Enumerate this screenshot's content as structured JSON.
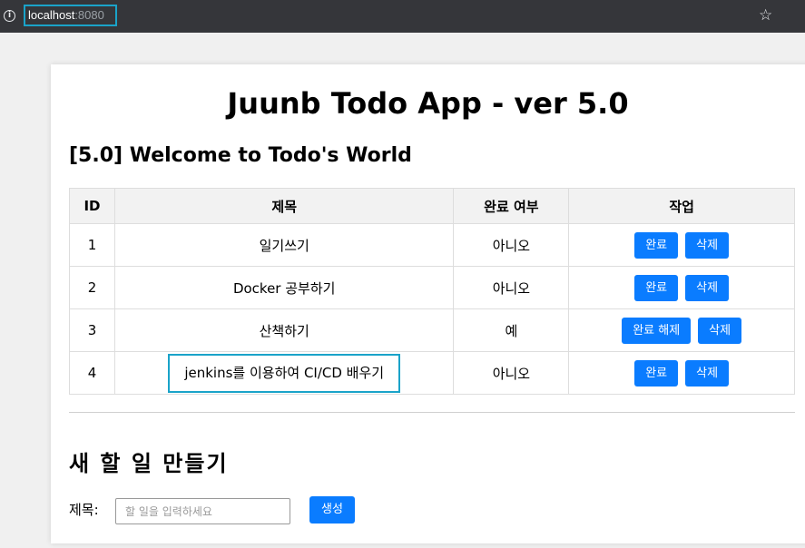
{
  "browser": {
    "url_host": "localhost",
    "url_port": ":8080",
    "info_icon": "info-icon",
    "bookmark_icon": "star-icon"
  },
  "app": {
    "title": "Juunb Todo App - ver 5.0",
    "welcome": "[5.0] Welcome to Todo's World"
  },
  "table": {
    "headers": [
      "ID",
      "제목",
      "완료 여부",
      "작업"
    ],
    "rows": [
      {
        "id": "1",
        "title": "일기쓰기",
        "done": "아니오",
        "toggle_label": "완료",
        "delete_label": "삭제"
      },
      {
        "id": "2",
        "title": "Docker 공부하기",
        "done": "아니오",
        "toggle_label": "완료",
        "delete_label": "삭제"
      },
      {
        "id": "3",
        "title": "산책하기",
        "done": "예",
        "toggle_label": "완료 해제",
        "delete_label": "삭제"
      },
      {
        "id": "4",
        "title": "jenkins를 이용하여 CI/CD 배우기",
        "done": "아니오",
        "toggle_label": "완료",
        "delete_label": "삭제"
      }
    ]
  },
  "create": {
    "heading": "새 할 일 만들기",
    "label": "제목:",
    "placeholder": "할 일을 입력하세요",
    "value": "",
    "button_label": "생성"
  },
  "colors": {
    "accent": "#0a7cff",
    "highlight": "#1aa3c9",
    "browser_bar": "#35363a"
  }
}
